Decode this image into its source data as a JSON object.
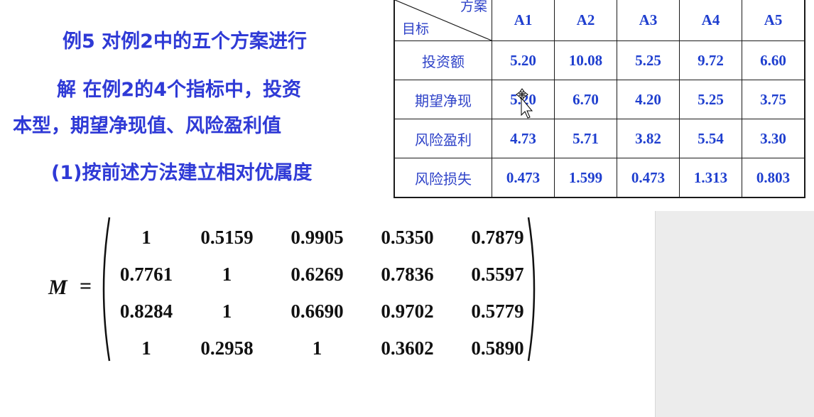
{
  "text_lines": {
    "line1": "例5 对例2中的五个方案进行",
    "line2": "解 在例2的4个指标中，投资",
    "line3": "本型，期望净现值、风险盈利值",
    "line4": "(1)按前述方法建立相对优属度"
  },
  "table": {
    "corner_top": "方案",
    "corner_bottom": "目标",
    "columns": [
      "A1",
      "A2",
      "A3",
      "A4",
      "A5"
    ],
    "rows": [
      {
        "label": "投资额",
        "values": [
          "5.20",
          "10.08",
          "5.25",
          "9.72",
          "6.60"
        ]
      },
      {
        "label": "期望净现",
        "values": [
          "5.20",
          "6.70",
          "4.20",
          "5.25",
          "3.75"
        ]
      },
      {
        "label": "风险盈利",
        "values": [
          "4.73",
          "5.71",
          "3.82",
          "5.54",
          "3.30"
        ]
      },
      {
        "label": "风险损失",
        "values": [
          "0.473",
          "1.599",
          "0.473",
          "1.313",
          "0.803"
        ]
      }
    ]
  },
  "matrix": {
    "label": "M",
    "equals": "=",
    "rows": [
      [
        "1",
        "0.5159",
        "0.9905",
        "0.5350",
        "0.7879"
      ],
      [
        "0.7761",
        "1",
        "0.6269",
        "0.7836",
        "0.5597"
      ],
      [
        "0.8284",
        "1",
        "0.6690",
        "0.9702",
        "0.5779"
      ],
      [
        "1",
        "0.2958",
        "1",
        "0.3602",
        "0.5890"
      ]
    ]
  },
  "colors": {
    "heading_blue": "#2f3ad6",
    "table_blue": "#1f3fcf",
    "panel_gray": "#ececec"
  },
  "icons": {
    "cursor": "move-cursor-icon"
  }
}
